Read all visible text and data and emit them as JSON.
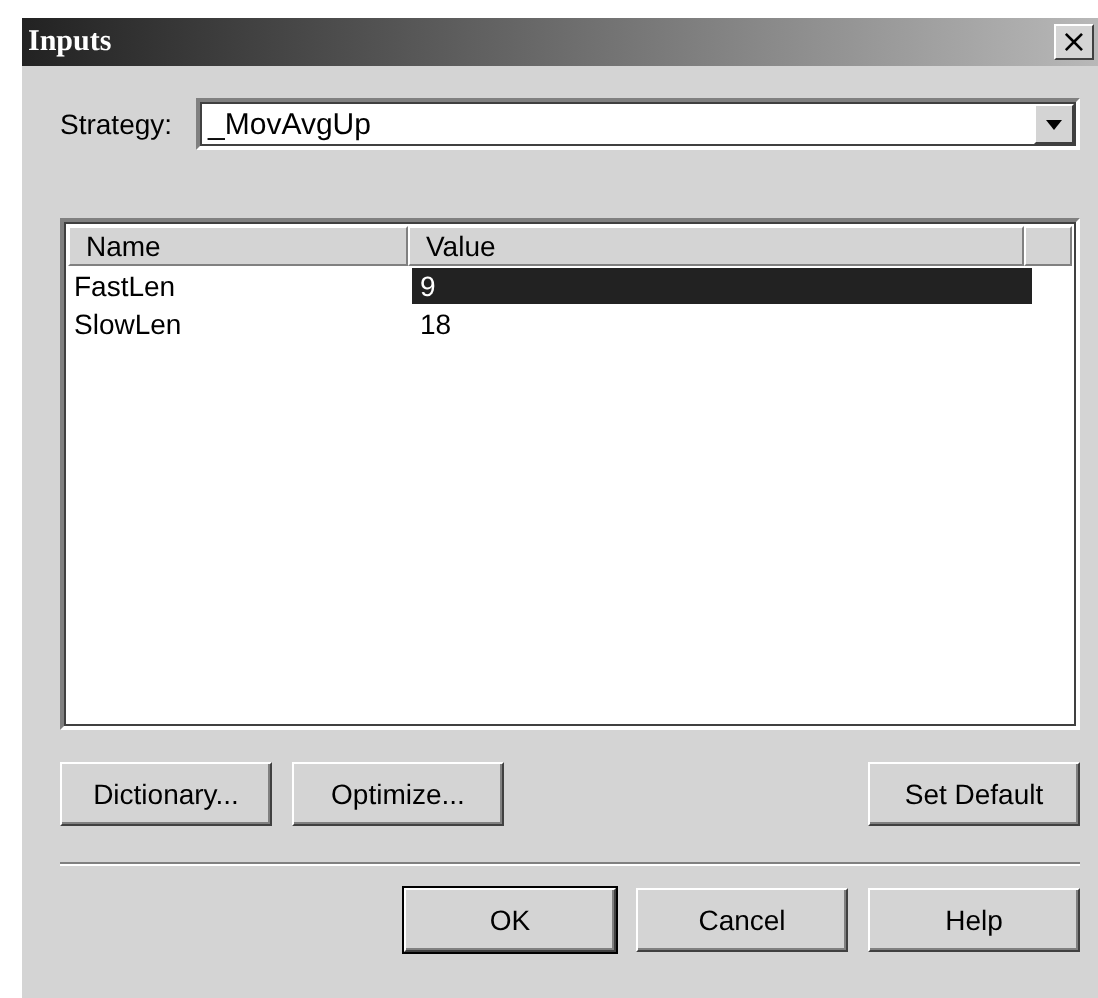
{
  "window": {
    "title": "Inputs",
    "close": "×"
  },
  "strategy": {
    "label": "Strategy:",
    "value": "_MovAvgUp"
  },
  "table": {
    "columns": [
      "Name",
      "Value"
    ],
    "rows": [
      {
        "name": "FastLen",
        "value": "9",
        "selected": true
      },
      {
        "name": "SlowLen",
        "value": "18",
        "selected": false
      }
    ]
  },
  "left_buttons": [
    "Dictionary...",
    "Optimize..."
  ],
  "right_buttons": [
    "Set Default"
  ],
  "buttons": [
    {
      "label": "OK",
      "default": true
    },
    {
      "label": "Cancel",
      "default": false
    },
    {
      "label": "Help",
      "default": false
    }
  ]
}
